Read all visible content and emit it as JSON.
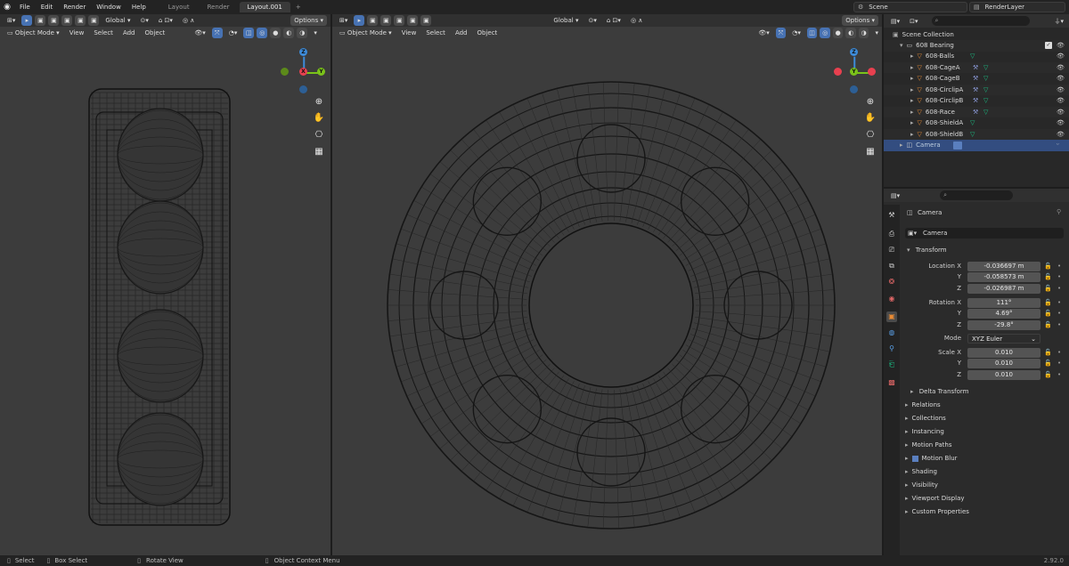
{
  "topbar": {
    "menus": [
      "File",
      "Edit",
      "Render",
      "Window",
      "Help"
    ],
    "workspaces": [
      "Layout",
      "Render",
      "Layout.001"
    ],
    "active_workspace": "Layout.001",
    "add_workspace": "+",
    "scene": "Scene",
    "render_layer": "RenderLayer"
  },
  "left_view": {
    "orientation": "Global",
    "options": "Options",
    "mode": "Object Mode",
    "menus": [
      "View",
      "Select",
      "Add",
      "Object"
    ]
  },
  "right_view": {
    "orientation": "Global",
    "options": "Options",
    "mode": "Object Mode",
    "menus": [
      "View",
      "Select",
      "Add",
      "Object"
    ]
  },
  "gizmo_axes": {
    "x": "X",
    "y": "Y",
    "z": "Z"
  },
  "outliner": {
    "root": "Scene Collection",
    "collection": "608 Bearing",
    "objects": [
      "608-Balls",
      "608-CageA",
      "608-CageB",
      "608-CirclipA",
      "608-CirclipB",
      "608-Race",
      "608-ShieldA",
      "608-ShieldB"
    ],
    "selected": "Camera"
  },
  "properties": {
    "object_name": "Camera",
    "object_field": "Camera",
    "transform_title": "Transform",
    "location_label": "Location X",
    "rotation_label": "Rotation X",
    "scale_label": "Scale X",
    "axis_y": "Y",
    "axis_z": "Z",
    "location": [
      "-0.036697 m",
      "-0.058573 m",
      "-0.026987 m"
    ],
    "rotation": [
      "111°",
      "4.69°",
      "-29.8°"
    ],
    "mode_label": "Mode",
    "mode_value": "XYZ Euler",
    "scale": [
      "0.010",
      "0.010",
      "0.010"
    ],
    "delta_transform": "Delta Transform",
    "panels": [
      "Relations",
      "Collections",
      "Instancing",
      "Motion Paths",
      "Motion Blur",
      "Shading",
      "Visibility",
      "Viewport Display",
      "Custom Properties"
    ]
  },
  "statusbar": {
    "items": [
      "Select",
      "Box Select",
      "Rotate View",
      "Object Context Menu"
    ],
    "version": "2.92.0"
  },
  "colors": {
    "x_axis": "#e8404f",
    "y_axis": "#7ac21a",
    "z_axis": "#3d8bd9",
    "selection": "#4772b3",
    "mesh_icon": "#e88a33",
    "modifier_icon": "#19c286",
    "constraint_icon": "#8a98d6"
  }
}
